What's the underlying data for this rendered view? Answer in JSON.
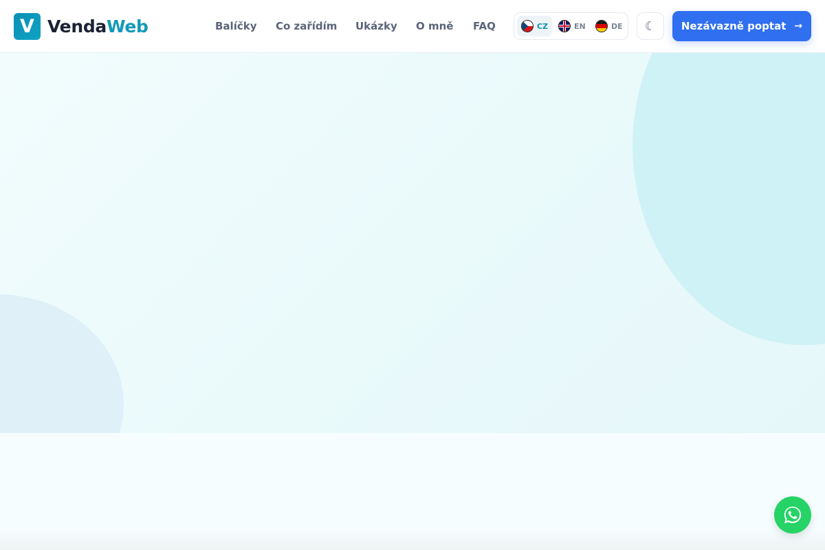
{
  "brand": {
    "logo_letter": "V",
    "name_part1": "Venda",
    "name_part2": "Web",
    "accent_color": "#1399b8"
  },
  "nav": {
    "items": [
      {
        "label": "Balíčky"
      },
      {
        "label": "Co zařídím"
      },
      {
        "label": "Ukázky"
      },
      {
        "label": "O mně"
      },
      {
        "label": "FAQ"
      }
    ]
  },
  "languages": {
    "selected": "CZ",
    "options": [
      {
        "code": "CZ",
        "icon": "czech-flag-icon"
      },
      {
        "code": "EN",
        "icon": "uk-flag-icon"
      },
      {
        "code": "DE",
        "icon": "german-flag-icon"
      }
    ]
  },
  "theme_toggle": {
    "icon": "moon-icon",
    "glyph": "☾"
  },
  "cta": {
    "label": "Nezávazně poptat",
    "arrow": "→",
    "color": "#2f6ff0"
  },
  "whatsapp": {
    "icon": "whatsapp-icon",
    "color": "#25d366"
  }
}
